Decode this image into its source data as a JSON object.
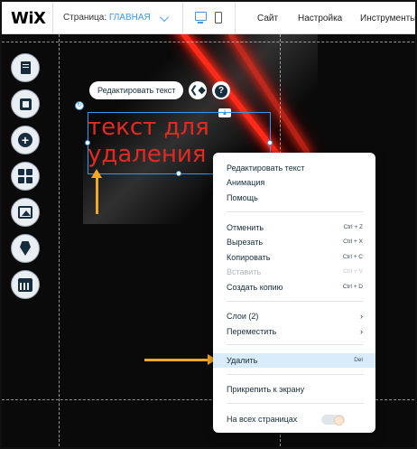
{
  "topbar": {
    "logo": "WiX",
    "page_label": "Страница:",
    "page_value": "ГЛАВНАЯ",
    "menu": [
      "Сайт",
      "Настройка",
      "Инструменты"
    ]
  },
  "tools": [
    {
      "name": "pages-icon"
    },
    {
      "name": "background-icon"
    },
    {
      "name": "add-icon"
    },
    {
      "name": "apps-icon"
    },
    {
      "name": "media-icon"
    },
    {
      "name": "blog-pen-icon"
    },
    {
      "name": "calendar-icon"
    }
  ],
  "element_toolbar": {
    "edit_text": "Редактировать текст",
    "help": "?"
  },
  "selected_text": {
    "line1": "текст для",
    "line2": "удаления"
  },
  "context_menu": {
    "items": [
      {
        "label": "Редактировать текст",
        "shortcut": ""
      },
      {
        "label": "Анимация",
        "shortcut": ""
      },
      {
        "label": "Помощь",
        "shortcut": ""
      },
      {
        "label": "Отменить",
        "shortcut": "Ctrl + Z"
      },
      {
        "label": "Вырезать",
        "shortcut": "Ctrl + X"
      },
      {
        "label": "Копировать",
        "shortcut": "Ctrl + C"
      },
      {
        "label": "Вставить",
        "shortcut": "Ctrl + V"
      },
      {
        "label": "Создать копию",
        "shortcut": "Ctrl + D"
      },
      {
        "label": "Слои (2)",
        "shortcut": "›"
      },
      {
        "label": "Переместить",
        "shortcut": "›"
      },
      {
        "label": "Удалить",
        "shortcut": "Del"
      },
      {
        "label": "Прикрепить к экрану",
        "shortcut": ""
      },
      {
        "label": "На всех страницах",
        "shortcut": ""
      }
    ]
  },
  "colors": {
    "accent": "#3899ec",
    "text_red": "#e02b20",
    "arrow_orange": "#f5a623",
    "highlight": "#d9ecfb"
  }
}
